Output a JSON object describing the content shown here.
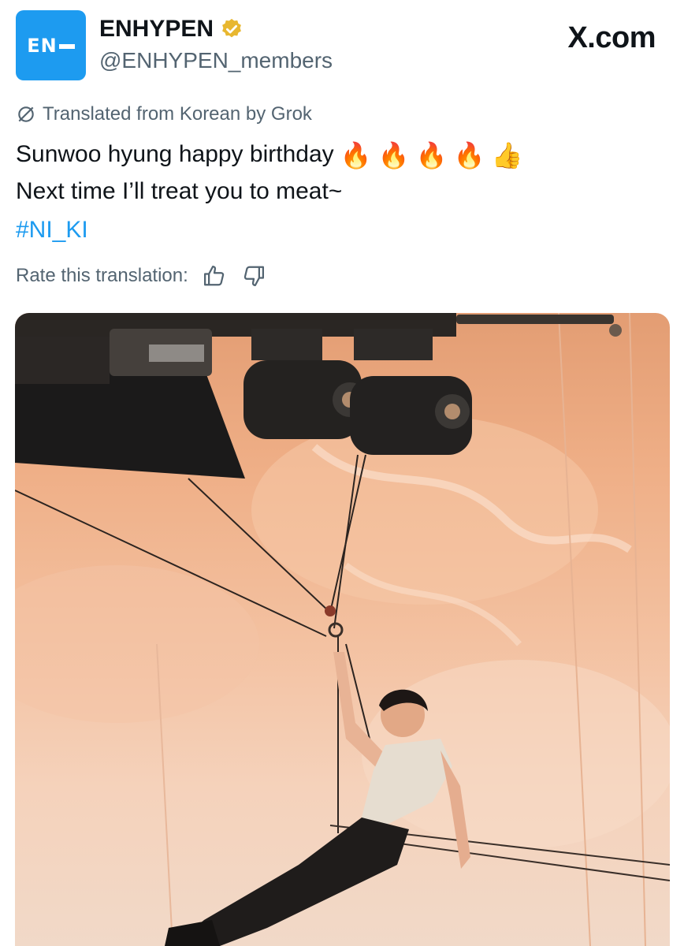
{
  "account": {
    "display_name": "ENHYPEN",
    "handle": "@ENHYPEN_members",
    "avatar_text": "EN"
  },
  "site_label": "X.com",
  "translation": {
    "notice": "Translated from Korean by Grok",
    "rate_label": "Rate this translation:"
  },
  "tweet": {
    "line1": "Sunwoo hyung happy birthday",
    "line1_emojis": [
      "🔥",
      "🔥",
      "🔥",
      "🔥",
      "👍"
    ],
    "line2": "Next time I’ll treat you to meat~",
    "hashtag": "#NI_KI"
  },
  "colors": {
    "accent": "#1d9bf0",
    "verified": "#e8b730",
    "secondary_text": "#536471"
  },
  "icons": {
    "verified": "verified-badge-icon",
    "translate": "slashed-circle-icon",
    "thumbs_up": "thumbs-up-icon",
    "thumbs_down": "thumbs-down-icon"
  }
}
